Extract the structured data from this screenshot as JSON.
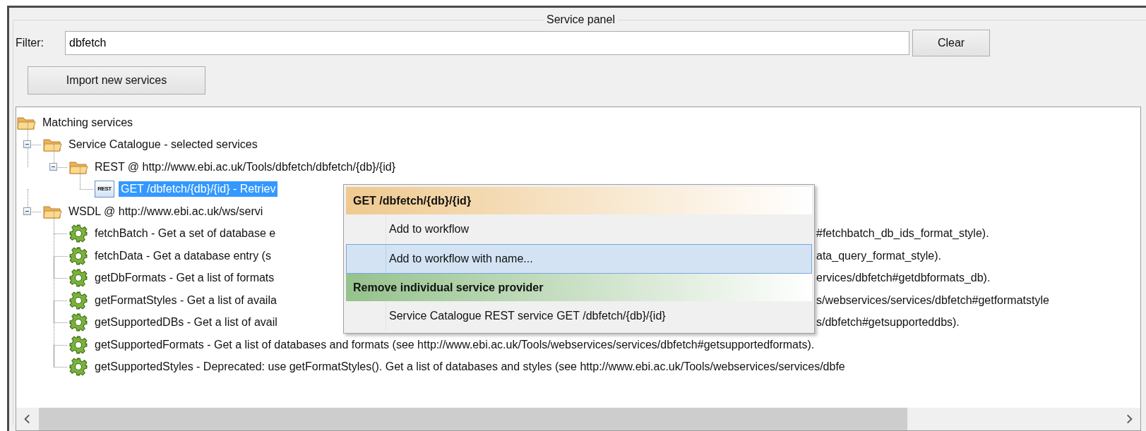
{
  "panel": {
    "title": "Service panel"
  },
  "filter": {
    "label": "Filter:",
    "value": "dbfetch",
    "clear_button": "Clear"
  },
  "import_button": "Import new services",
  "tree": [
    {
      "kind": "folder",
      "text": "Matching services",
      "selected": false,
      "children": [
        {
          "kind": "folder",
          "text": "Service Catalogue - selected services",
          "expanded": true,
          "selected": false,
          "children": [
            {
              "kind": "folder",
              "text": "REST @ http://www.ebi.ac.uk/Tools/dbfetch/dbfetch/{db}/{id}",
              "expanded": true,
              "selected": false,
              "children": [
                {
                  "kind": "rest",
                  "icon_text": "REST",
                  "text": "GET /dbfetch/{db}/{id} - Retriev",
                  "selected": true
                }
              ]
            }
          ]
        },
        {
          "kind": "folder",
          "text": "WSDL @ http://www.ebi.ac.uk/ws/servi",
          "expanded": true,
          "selected": false,
          "children": [
            {
              "kind": "operation",
              "text": "fetchBatch - Get a set of database e",
              "text_right": "#fetchbatch_db_ids_format_style).",
              "selected": false
            },
            {
              "kind": "operation",
              "text": "fetchData - Get a database entry (s",
              "text_right": "ata_query_format_style).",
              "selected": false
            },
            {
              "kind": "operation",
              "text": "getDbFormats - Get a list of formats",
              "text_right": "ervices/dbfetch#getdbformats_db).",
              "selected": false
            },
            {
              "kind": "operation",
              "text": "getFormatStyles - Get a list of availa",
              "text_right": "s/webservices/services/dbfetch#getformatstyle",
              "selected": false
            },
            {
              "kind": "operation",
              "text": "getSupportedDBs - Get a list of avail",
              "text_right": "s/dbfetch#getsupporteddbs).",
              "selected": false
            },
            {
              "kind": "operation",
              "text": "getSupportedFormats - Get a list of databases and formats (see http://www.ebi.ac.uk/Tools/webservices/services/dbfetch#getsupportedformats).",
              "selected": false
            },
            {
              "kind": "operation",
              "text": "getSupportedStyles - Deprecated: use getFormatStyles(). Get a list of databases and styles (see http://www.ebi.ac.uk/Tools/webservices/services/dbfe",
              "selected": false
            }
          ]
        }
      ]
    }
  ],
  "context_menu": [
    {
      "kind": "header",
      "label": "GET /dbfetch/{db}/{id}",
      "color": "#efc98f",
      "selected": false
    },
    {
      "kind": "item",
      "label": "Add to workflow",
      "selected": false
    },
    {
      "kind": "item",
      "label": "Add to workflow with name...",
      "selected": true
    },
    {
      "kind": "header",
      "label": "Remove individual service provider",
      "color": "#95c28d",
      "selected": false
    },
    {
      "kind": "item",
      "label": "Service Catalogue REST service GET /dbfetch/{db}/{id}",
      "selected": false
    }
  ]
}
